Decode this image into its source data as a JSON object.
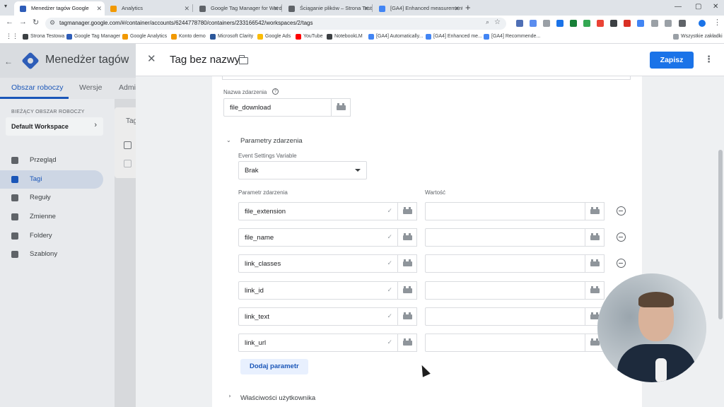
{
  "browser": {
    "tabs": [
      {
        "title": "Menedżer tagów Google",
        "active": true,
        "favicon": "gtm-icon",
        "color": "#2e5db8"
      },
      {
        "title": "Analytics",
        "active": false,
        "favicon": "analytics-icon",
        "color": "#f29900"
      },
      {
        "title": "Google Tag Manager for WordPress",
        "active": false,
        "favicon": "globe-icon",
        "color": "#5f6368"
      },
      {
        "title": "Ściąganie plików – Strona Testowa",
        "active": false,
        "favicon": "globe-icon",
        "color": "#5f6368"
      },
      {
        "title": "[GA4] Enhanced measurement",
        "active": false,
        "favicon": "google-icon",
        "color": "#4285f4"
      }
    ],
    "url": "tagmanager.google.com/#/container/accounts/6244778780/containers/233166542/workspaces/2/tags",
    "bookmarks": [
      {
        "label": "Strona Testowa",
        "color": "#3c4043"
      },
      {
        "label": "Google Tag Manager",
        "color": "#2e5db8"
      },
      {
        "label": "Google Analytics",
        "color": "#f29900"
      },
      {
        "label": "Konto demo",
        "color": "#f29900"
      },
      {
        "label": "Microsoft Clarity",
        "color": "#2b579a"
      },
      {
        "label": "Google Ads",
        "color": "#fbbc04"
      },
      {
        "label": "YouTube",
        "color": "#ff0000"
      },
      {
        "label": "NotebookLM",
        "color": "#3c4043"
      },
      {
        "label": "[GA4] Automatically...",
        "color": "#4285f4"
      },
      {
        "label": "[GA4] Enhanced me...",
        "color": "#4285f4"
      },
      {
        "label": "[GA4] Recommende...",
        "color": "#4285f4"
      }
    ],
    "all_bookmarks": "Wszystkie zakładki"
  },
  "gtm": {
    "app_title": "Menedżer tagów",
    "nav_tabs": [
      "Obszar roboczy",
      "Wersje",
      "Admi"
    ],
    "workspace_label": "BIEŻĄCY OBSZAR ROBOCZY",
    "workspace_name": "Default Workspace",
    "sidebar": [
      {
        "label": "Przegląd",
        "icon": "overview-icon",
        "active": false
      },
      {
        "label": "Tagi",
        "icon": "tag-icon",
        "active": true
      },
      {
        "label": "Reguły",
        "icon": "trigger-icon",
        "active": false
      },
      {
        "label": "Zmienne",
        "icon": "variable-icon",
        "active": false
      },
      {
        "label": "Foldery",
        "icon": "folder-icon",
        "active": false
      },
      {
        "label": "Szablony",
        "icon": "template-icon",
        "active": false
      }
    ],
    "bg_card_title": "Tag"
  },
  "editor": {
    "title": "Tag bez nazwy",
    "save_label": "Zapisz",
    "event_name_label": "Nazwa zdarzenia",
    "event_name_value": "file_download",
    "event_params_section": "Parametry zdarzenia",
    "event_settings_label": "Event Settings Variable",
    "event_settings_value": "Brak",
    "param_col_label": "Parametr zdarzenia",
    "value_col_label": "Wartość",
    "params": [
      {
        "name": "file_extension",
        "value": ""
      },
      {
        "name": "file_name",
        "value": ""
      },
      {
        "name": "link_classes",
        "value": ""
      },
      {
        "name": "link_id",
        "value": ""
      },
      {
        "name": "link_text",
        "value": ""
      },
      {
        "name": "link_url",
        "value": ""
      }
    ],
    "add_param_label": "Dodaj parametr",
    "user_props_section": "Właściwości użytkownika"
  }
}
